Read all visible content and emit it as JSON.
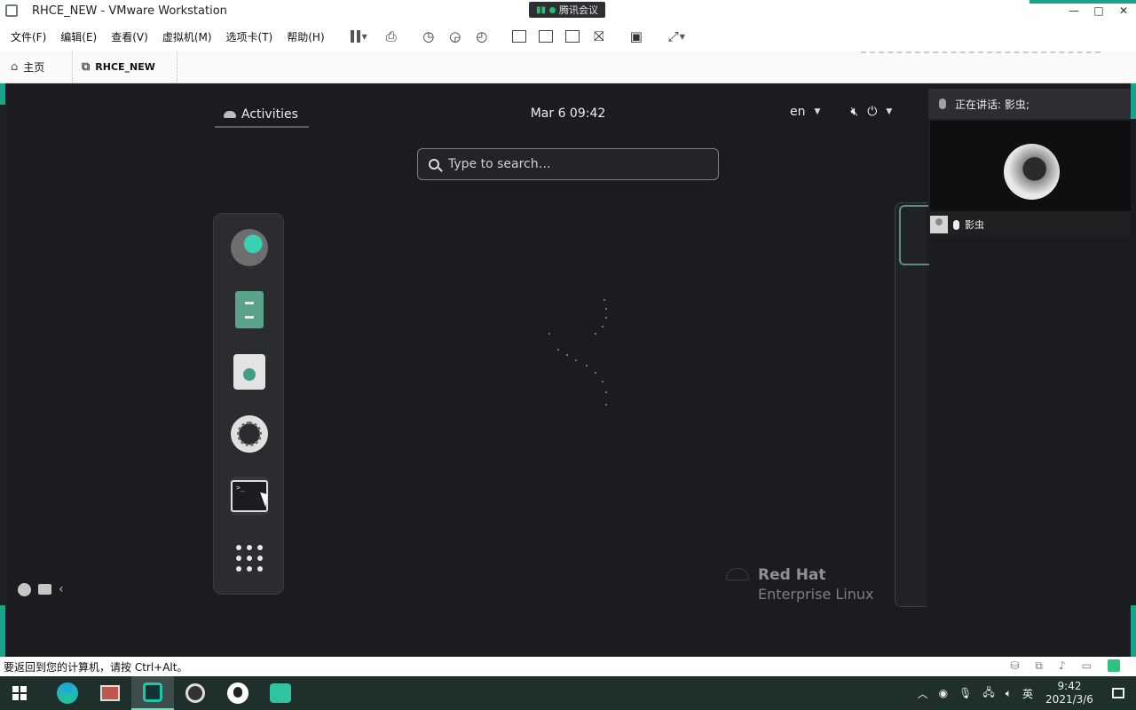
{
  "window": {
    "title": "RHCE_NEW - VMware Workstation",
    "meeting_tag": "腾讯会议",
    "controls": [
      "—",
      "□",
      "✕"
    ]
  },
  "menu": {
    "items": [
      "文件(F)",
      "编辑(E)",
      "查看(V)",
      "虚拟机(M)",
      "选项卡(T)",
      "帮助(H)"
    ]
  },
  "tabs": {
    "home": "主页",
    "vm": "RHCE_NEW"
  },
  "gnome": {
    "activities": "Activities",
    "clock": "Mar 6  09:42",
    "lang": "en",
    "search_placeholder": "Type to search…",
    "terminal_prompt": ">_",
    "logo_line1": "Red Hat",
    "logo_line2": "Enterprise Linux"
  },
  "meeting": {
    "speaking_label": "正在讲话: 影虫;",
    "participant": "影虫"
  },
  "statusbar": {
    "message": "要返回到您的计算机，请按 Ctrl+Alt。"
  },
  "taskbar": {
    "ime": "英",
    "time": "9:42",
    "date": "2021/3/6"
  },
  "colors": {
    "accent": "#17a589",
    "gnome_bg": "#1b1c1f",
    "taskbar_bg": "#1f2f2c"
  }
}
